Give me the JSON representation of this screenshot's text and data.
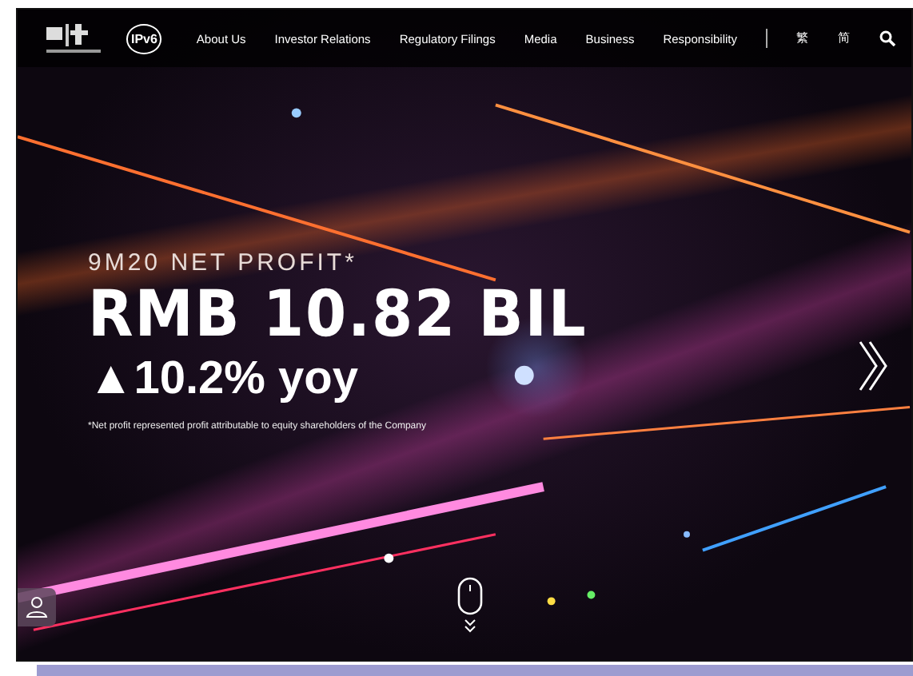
{
  "header": {
    "badge": "IPv6",
    "nav": [
      {
        "label": "About Us"
      },
      {
        "label": "Investor Relations"
      },
      {
        "label": "Regulatory Filings"
      },
      {
        "label": "Media"
      },
      {
        "label": "Business"
      },
      {
        "label": "Responsibility"
      }
    ],
    "languages": [
      {
        "label": "繁"
      },
      {
        "label": "简"
      }
    ]
  },
  "hero": {
    "kicker": "9M20 NET PROFIT*",
    "headline": "RMB 10.82 BIL",
    "growth": "▲10.2% yoy",
    "footnote": "*Net profit represented profit attributable to equity shareholders of the Company"
  }
}
